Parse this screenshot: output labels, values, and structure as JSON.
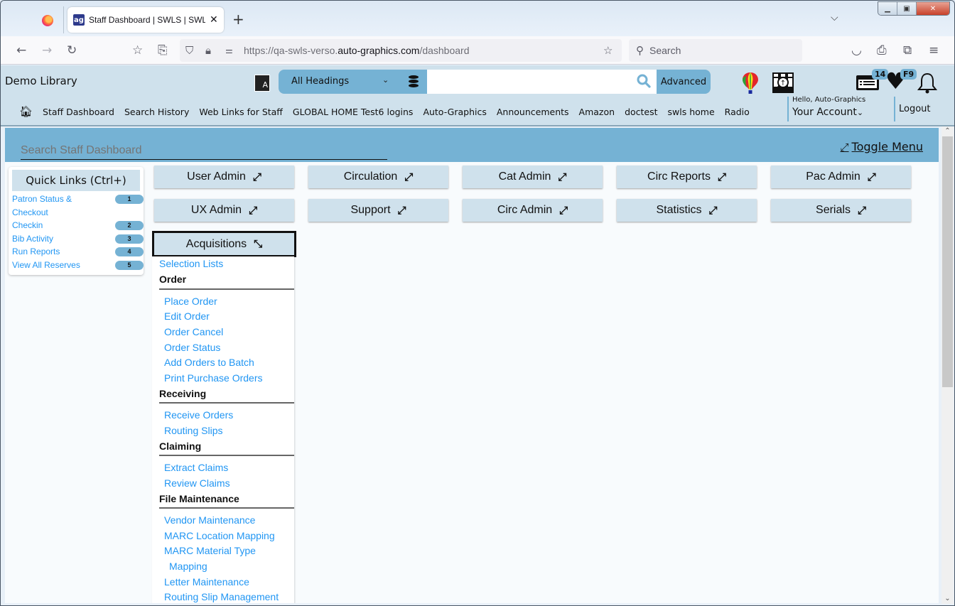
{
  "browser": {
    "tab_title": "Staff Dashboard | SWLS | SWLS |",
    "tab_favicon": "ag",
    "url_prefix": "https://qa-swls-verso.",
    "url_domain": "auto-graphics.com",
    "url_path": "/dashboard",
    "search_placeholder": "Search",
    "icons": [
      "firefox-icon",
      "back-icon",
      "forward-icon",
      "reload-icon",
      "bookmark-manager-icon",
      "share-icon",
      "shield-icon",
      "lock-icon",
      "permissions-icon",
      "star-icon",
      "pocket-icon",
      "print-icon",
      "extensions-icon",
      "menu-icon"
    ]
  },
  "header": {
    "library_name": "Demo Library",
    "search": {
      "scope": "All Headings",
      "query": "",
      "advanced_label": "Advanced"
    },
    "badges": {
      "list_count": "14",
      "favorites_key": "F9"
    },
    "greeting": "Hello, Auto-Graphics",
    "account_label": "Your Account",
    "logout_label": "Logout",
    "nav_links": [
      "Staff Dashboard",
      "Search History",
      "Web Links for Staff",
      "GLOBAL HOME Test6 logins",
      "Auto-Graphics",
      "Announcements",
      "Amazon",
      "doctest",
      "swls home",
      "Radio"
    ]
  },
  "dashboard": {
    "search_placeholder": "Search Staff Dashboard",
    "toggle_menu_label": "Toggle Menu",
    "quick_links": {
      "title": "Quick Links (Ctrl+)",
      "items": [
        {
          "label": "Patron Status &",
          "label2": "Checkout",
          "key": "1"
        },
        {
          "label": "Checkin",
          "key": "2"
        },
        {
          "label": "Bib Activity",
          "key": "3"
        },
        {
          "label": "Run Reports",
          "key": "4"
        },
        {
          "label": "View All Reserves",
          "key": "5"
        }
      ]
    },
    "modules": [
      {
        "label": "User Admin",
        "state": "collapsed"
      },
      {
        "label": "Circulation",
        "state": "collapsed"
      },
      {
        "label": "Cat Admin",
        "state": "collapsed"
      },
      {
        "label": "Circ Reports",
        "state": "collapsed"
      },
      {
        "label": "Pac Admin",
        "state": "collapsed"
      },
      {
        "label": "UX Admin",
        "state": "collapsed"
      },
      {
        "label": "Support",
        "state": "collapsed"
      },
      {
        "label": "Circ Admin",
        "state": "collapsed"
      },
      {
        "label": "Statistics",
        "state": "collapsed"
      },
      {
        "label": "Serials",
        "state": "collapsed"
      },
      {
        "label": "Acquisitions",
        "state": "expanded"
      }
    ],
    "acquisitions_menu": {
      "top_link": "Selection Lists",
      "sections": [
        {
          "heading": "Order",
          "links": [
            "Place Order",
            "Edit Order",
            "Order Cancel",
            "Order Status",
            "Add Orders to Batch",
            "Print Purchase Orders"
          ]
        },
        {
          "heading": "Receiving",
          "links": [
            "Receive Orders",
            "Routing Slips"
          ]
        },
        {
          "heading": "Claiming",
          "links": [
            "Extract Claims",
            "Review Claims"
          ]
        },
        {
          "heading": "File Maintenance",
          "links": [
            "Vendor Maintenance",
            "MARC Location Mapping",
            "MARC Material Type",
            "Mapping",
            "Letter Maintenance",
            "Routing Slip Management"
          ]
        }
      ]
    }
  }
}
